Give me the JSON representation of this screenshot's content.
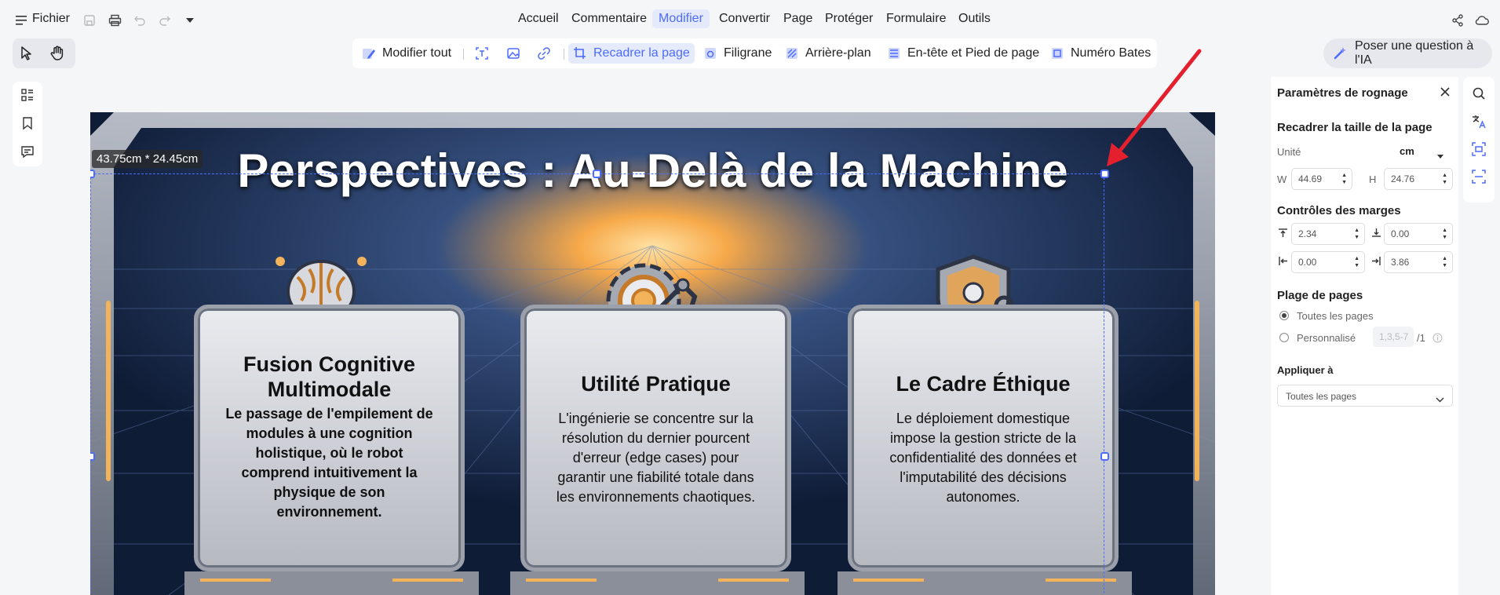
{
  "menubar": {
    "file_label": "Fichier",
    "items": [
      "Accueil",
      "Commentaire",
      "Modifier",
      "Convertir",
      "Page",
      "Protéger",
      "Formulaire",
      "Outils"
    ]
  },
  "ribbon": {
    "edit_all": "Modifier tout",
    "crop_page": "Recadrer la page",
    "watermark": "Filigrane",
    "background": "Arrière-plan",
    "header_footer": "En-tête et Pied de page",
    "bates": "Numéro Bates"
  },
  "ask_ai": "Poser une question à l'IA",
  "canvas": {
    "dimension_readout": "43.75cm * 24.45cm",
    "slide_title": "Perspectives : Au-Delà de la Machine",
    "panels": [
      {
        "title": "Fusion Cognitive Multimodale",
        "body": "Le passage de l'empilement de modules à une cognition holistique, où le robot comprend intuitivement la physique de son environnement."
      },
      {
        "title": "Utilité Pratique",
        "body": "L'ingénierie se concentre sur la résolution du dernier pourcent d'erreur (edge cases) pour garantir une fiabilité totale dans les environnements chaotiques."
      },
      {
        "title": "Le Cadre Éthique",
        "body": "Le déploiement domestique impose la gestion stricte de la confidentialité des données et l'imputabilité des décisions autonomes."
      }
    ]
  },
  "sidebar": {
    "title": "Paramètres de rognage",
    "section_size": "Recadrer la taille de la page",
    "unit_label": "Unité",
    "unit_value": "cm",
    "w_label": "W",
    "w_value": "44.69",
    "h_label": "H",
    "h_value": "24.76",
    "section_margins": "Contrôles des marges",
    "margin_top": "2.34",
    "margin_bottom": "0.00",
    "margin_left": "0.00",
    "margin_right": "3.86",
    "section_range": "Plage de pages",
    "all_pages": "Toutes les pages",
    "custom": "Personnalisé",
    "custom_placeholder": "1,3,5-7",
    "custom_total": "/1",
    "section_apply": "Appliquer à",
    "apply_value": "Toutes les pages"
  },
  "colors": {
    "accent": "#4d6bfe",
    "annotation_arrow": "#e5202e"
  }
}
